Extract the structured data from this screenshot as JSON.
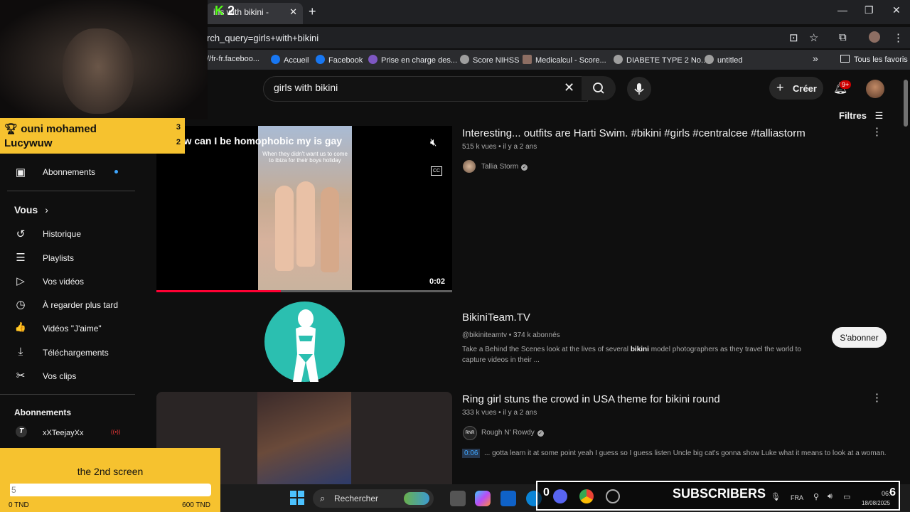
{
  "browser": {
    "tab_title": "irls with bikini - YouTube",
    "tab_close": "✕",
    "new_tab": "+",
    "url": "rch_query=girls+with+bikini",
    "bookmarks": [
      {
        "label": "//fr-fr.faceboo...",
        "icon_color": "#1877f2"
      },
      {
        "label": "Accueil",
        "icon_color": "#1877f2"
      },
      {
        "label": "Facebook",
        "icon_color": "#1877f2"
      },
      {
        "label": "Prise en charge des...",
        "icon_color": "#7e57c2"
      },
      {
        "label": "Score NIHSS",
        "icon_color": "#9e9e9e"
      },
      {
        "label": "Medicalcul - Score...",
        "icon_color": "#8d6e63"
      },
      {
        "label": "DIABETE TYPE 2 No...",
        "icon_color": "#9e9e9e"
      },
      {
        "label": "untitled",
        "icon_color": "#9e9e9e"
      }
    ],
    "all_favorites": "Tous les favoris",
    "more_bookmarks": "»"
  },
  "stream": {
    "kick_count": "2",
    "ticker": {
      "name1": "ouni mohamed",
      "name2": "Lucywuw",
      "count1": "3",
      "count2": "2"
    },
    "goal": {
      "label": "the 2nd screen",
      "value": "5",
      "min": "0 TND",
      "max": "600 TND",
      "progress": 0.008
    },
    "subs": {
      "left_count": "0",
      "label": "SUBSCRIBERS",
      "right_count": "6"
    }
  },
  "sidebar": {
    "items": [
      {
        "label": "Abonnements",
        "icon": "subscriptions-icon",
        "glyph": "▣",
        "dot": true
      },
      {
        "label": "Historique",
        "icon": "history-icon",
        "glyph": "↺"
      },
      {
        "label": "Playlists",
        "icon": "playlists-icon",
        "glyph": "☰"
      },
      {
        "label": "Vos vidéos",
        "icon": "your-videos-icon",
        "glyph": "▷"
      },
      {
        "label": "À regarder plus tard",
        "icon": "watch-later-icon",
        "glyph": "◷"
      },
      {
        "label": "Vidéos \"J'aime\"",
        "icon": "like-icon",
        "glyph": "👍"
      },
      {
        "label": "Téléchargements",
        "icon": "download-icon",
        "glyph": "⤓"
      },
      {
        "label": "Vos clips",
        "icon": "clips-icon",
        "glyph": "✂"
      }
    ],
    "you_label": "Vous",
    "subscriptions_heading": "Abonnements",
    "subscription_channel": "xXTeejayXx",
    "live_glyph": "((•))"
  },
  "header": {
    "search_value": "girls with bikini",
    "create_label": "Créer",
    "notif_count": "9+",
    "filters_label": "Filtres"
  },
  "results": [
    {
      "title": "Interesting... outfits are Harti Swim. #bikini #girls #centralcee #talliastorm",
      "views": "515 k vues",
      "age": "il y a 2 ans",
      "channel": "Tallia Storm",
      "overlay_text": "ow can I be homophobic my is gay",
      "caption": "When they didn't want us to come to ibiza for their boys holiday",
      "duration": "0:02",
      "progress": 0.42
    },
    {
      "title": "BikiniTeam.TV",
      "handle": "@bikiniteamtv",
      "subscribers": "374 k abonnés",
      "description_before": "Take a Behind the Scenes look at the lives of several ",
      "description_bold": "bikini",
      "description_after": " model photographers as they travel the world to capture videos in their ...",
      "subscribe_label": "S'abonner"
    },
    {
      "title": "Ring girl stuns the crowd in USA theme for bikini round",
      "views": "333 k vues",
      "age": "il y a 2 ans",
      "channel": "Rough N' Rowdy",
      "timestamp": "0:06",
      "snippet": "... gotta learn it at some point yeah I guess so I guess listen Uncle big cat's gonna show Luke what it means to look at a woman."
    }
  ],
  "taskbar": {
    "search_label": "Rechercher",
    "lang": "FRA",
    "time": "06:",
    "date": "18/08/2025"
  }
}
